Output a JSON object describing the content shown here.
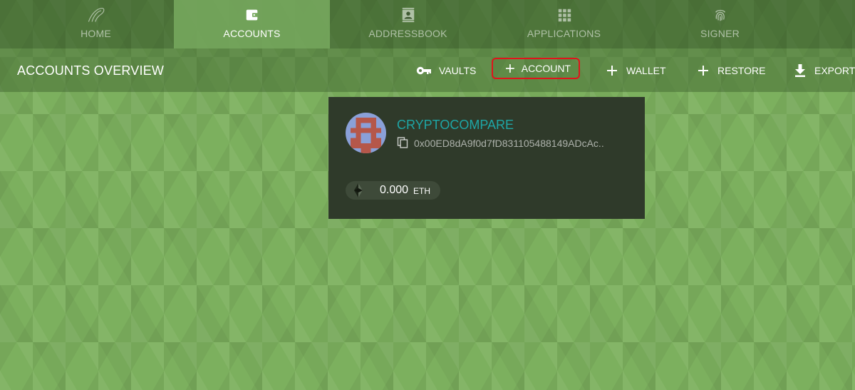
{
  "nav": {
    "tabs": [
      {
        "label": "HOME",
        "icon": "home-swirl-icon",
        "active": false
      },
      {
        "label": "ACCOUNTS",
        "icon": "wallet-icon",
        "active": true
      },
      {
        "label": "ADDRESSBOOK",
        "icon": "contact-card-icon",
        "active": false
      },
      {
        "label": "APPLICATIONS",
        "icon": "grid-icon",
        "active": false
      },
      {
        "label": "SIGNER",
        "icon": "fingerprint-icon",
        "active": false
      }
    ]
  },
  "header": {
    "title": "ACCOUNTS OVERVIEW",
    "actions": {
      "vaults": "VAULTS",
      "account": "ACCOUNT",
      "wallet": "WALLET",
      "restore": "RESTORE",
      "export": "EXPORT"
    }
  },
  "account": {
    "name": "CRYPTOCOMPARE",
    "address": "0x00ED8dA9f0d7fD831105488149ADcAc..",
    "balance": "0.000",
    "unit": "ETH"
  },
  "colors": {
    "background": "#7cb05e",
    "active_tab": "#78aa5f",
    "card": "#2f3a2a",
    "account_name": "#1ea6a6",
    "highlight_border": "#e0141b"
  }
}
